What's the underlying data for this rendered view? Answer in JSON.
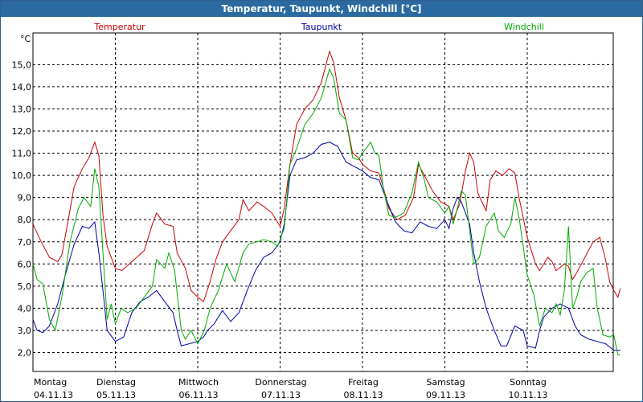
{
  "window": {
    "title": "Temperatur, Taupunkt, Windchill [°C]"
  },
  "chart_data": {
    "type": "line",
    "title": "Temperatur, Taupunkt, Windchill [°C]",
    "ylabel": "°C",
    "ylim": [
      1.5,
      16.5
    ],
    "xlim": [
      0,
      7.05
    ],
    "grid": true,
    "legend_placement": "top",
    "yticks": [
      2,
      3,
      4,
      5,
      6,
      7,
      8,
      9,
      10,
      11,
      12,
      13,
      14,
      15
    ],
    "ytick_labels": [
      "2,0",
      "3,0",
      "4,0",
      "5,0",
      "6,0",
      "7,0",
      "8,0",
      "9,0",
      "10,0",
      "11,0",
      "12,0",
      "13,0",
      "14,0",
      "15,0"
    ],
    "x_day_labels": [
      {
        "day": "Montag",
        "date": "04.11.13"
      },
      {
        "day": "Dienstag",
        "date": "05.11.13"
      },
      {
        "day": "Mittwoch",
        "date": "06.11.13"
      },
      {
        "day": "Donnerstag",
        "date": "07.11.13"
      },
      {
        "day": "Freitag",
        "date": "08.11.13"
      },
      {
        "day": "Samstag",
        "date": "09.11.13"
      },
      {
        "day": "Sonntag",
        "date": "10.11.13"
      }
    ],
    "series": [
      {
        "name": "Temperatur",
        "color": "#cc0000",
        "points": [
          [
            0,
            7.8
          ],
          [
            0.1,
            7.0
          ],
          [
            0.2,
            6.3
          ],
          [
            0.3,
            6.1
          ],
          [
            0.35,
            6.4
          ],
          [
            0.42,
            7.8
          ],
          [
            0.5,
            9.5
          ],
          [
            0.6,
            10.3
          ],
          [
            0.68,
            10.8
          ],
          [
            0.75,
            11.5
          ],
          [
            0.8,
            10.9
          ],
          [
            0.85,
            8.2
          ],
          [
            0.9,
            6.8
          ],
          [
            1.0,
            5.8
          ],
          [
            1.08,
            5.7
          ],
          [
            1.2,
            6.1
          ],
          [
            1.35,
            6.6
          ],
          [
            1.45,
            7.8
          ],
          [
            1.5,
            8.3
          ],
          [
            1.6,
            7.8
          ],
          [
            1.7,
            7.7
          ],
          [
            1.75,
            6.5
          ],
          [
            1.85,
            5.8
          ],
          [
            1.92,
            4.8
          ],
          [
            2.0,
            4.5
          ],
          [
            2.07,
            4.3
          ],
          [
            2.15,
            5.2
          ],
          [
            2.22,
            6.2
          ],
          [
            2.3,
            7.0
          ],
          [
            2.42,
            7.6
          ],
          [
            2.5,
            8.0
          ],
          [
            2.55,
            8.9
          ],
          [
            2.62,
            8.4
          ],
          [
            2.72,
            8.8
          ],
          [
            2.8,
            8.6
          ],
          [
            2.9,
            8.3
          ],
          [
            3.0,
            7.7
          ],
          [
            3.05,
            8.5
          ],
          [
            3.12,
            10.5
          ],
          [
            3.2,
            12.3
          ],
          [
            3.3,
            13.0
          ],
          [
            3.4,
            13.4
          ],
          [
            3.5,
            14.2
          ],
          [
            3.6,
            15.6
          ],
          [
            3.65,
            15.1
          ],
          [
            3.72,
            13.5
          ],
          [
            3.8,
            12.5
          ],
          [
            3.88,
            11.0
          ],
          [
            3.95,
            10.8
          ],
          [
            4.0,
            10.5
          ],
          [
            4.1,
            10.2
          ],
          [
            4.2,
            10.1
          ],
          [
            4.25,
            9.5
          ],
          [
            4.32,
            8.5
          ],
          [
            4.42,
            8.0
          ],
          [
            4.52,
            8.2
          ],
          [
            4.62,
            9.0
          ],
          [
            4.68,
            10.5
          ],
          [
            4.75,
            10.0
          ],
          [
            4.85,
            9.3
          ],
          [
            4.95,
            8.8
          ],
          [
            5.05,
            8.6
          ],
          [
            5.1,
            8.0
          ],
          [
            5.18,
            8.7
          ],
          [
            5.25,
            10.2
          ],
          [
            5.3,
            11.0
          ],
          [
            5.35,
            10.6
          ],
          [
            5.4,
            9.2
          ],
          [
            5.45,
            8.8
          ],
          [
            5.5,
            8.4
          ],
          [
            5.55,
            9.8
          ],
          [
            5.62,
            10.2
          ],
          [
            5.7,
            10.0
          ],
          [
            5.78,
            10.3
          ],
          [
            5.85,
            10.1
          ],
          [
            5.9,
            9.0
          ],
          [
            6.0,
            7.2
          ],
          [
            6.1,
            6.0
          ],
          [
            6.15,
            5.7
          ],
          [
            6.2,
            6.0
          ],
          [
            6.25,
            6.3
          ],
          [
            6.3,
            6.1
          ],
          [
            6.35,
            5.7
          ],
          [
            6.45,
            6.0
          ],
          [
            6.5,
            5.9
          ],
          [
            6.55,
            5.3
          ],
          [
            6.6,
            5.6
          ],
          [
            6.7,
            6.3
          ],
          [
            6.8,
            7.0
          ],
          [
            6.88,
            7.2
          ],
          [
            6.95,
            6.2
          ],
          [
            7.0,
            5.2
          ],
          [
            7.05,
            4.8
          ],
          [
            7.1,
            4.5
          ],
          [
            7.13,
            4.9
          ]
        ]
      },
      {
        "name": "Taupunkt",
        "color": "#0000aa",
        "points": [
          [
            0,
            3.5
          ],
          [
            0.05,
            3.0
          ],
          [
            0.12,
            2.9
          ],
          [
            0.2,
            3.2
          ],
          [
            0.3,
            4.2
          ],
          [
            0.4,
            5.6
          ],
          [
            0.5,
            6.9
          ],
          [
            0.6,
            7.7
          ],
          [
            0.68,
            7.6
          ],
          [
            0.75,
            7.9
          ],
          [
            0.8,
            6.5
          ],
          [
            0.85,
            4.8
          ],
          [
            0.9,
            3.0
          ],
          [
            1.0,
            2.5
          ],
          [
            1.1,
            2.7
          ],
          [
            1.2,
            3.8
          ],
          [
            1.3,
            4.3
          ],
          [
            1.4,
            4.5
          ],
          [
            1.5,
            4.8
          ],
          [
            1.6,
            4.3
          ],
          [
            1.7,
            3.8
          ],
          [
            1.75,
            3.0
          ],
          [
            1.8,
            2.3
          ],
          [
            1.9,
            2.4
          ],
          [
            2.0,
            2.5
          ],
          [
            2.07,
            2.7
          ],
          [
            2.12,
            3.0
          ],
          [
            2.2,
            3.3
          ],
          [
            2.3,
            3.9
          ],
          [
            2.4,
            3.4
          ],
          [
            2.5,
            3.8
          ],
          [
            2.6,
            4.8
          ],
          [
            2.7,
            5.7
          ],
          [
            2.8,
            6.3
          ],
          [
            2.9,
            6.5
          ],
          [
            3.0,
            7.0
          ],
          [
            3.05,
            7.8
          ],
          [
            3.12,
            10.0
          ],
          [
            3.2,
            10.7
          ],
          [
            3.3,
            10.8
          ],
          [
            3.4,
            11.0
          ],
          [
            3.5,
            11.4
          ],
          [
            3.6,
            11.5
          ],
          [
            3.7,
            11.3
          ],
          [
            3.8,
            10.6
          ],
          [
            3.9,
            10.4
          ],
          [
            4.0,
            10.2
          ],
          [
            4.1,
            9.9
          ],
          [
            4.2,
            9.8
          ],
          [
            4.3,
            8.8
          ],
          [
            4.4,
            7.9
          ],
          [
            4.5,
            7.5
          ],
          [
            4.6,
            7.4
          ],
          [
            4.7,
            7.9
          ],
          [
            4.8,
            7.7
          ],
          [
            4.9,
            7.6
          ],
          [
            5.0,
            8.0
          ],
          [
            5.05,
            7.6
          ],
          [
            5.1,
            8.5
          ],
          [
            5.15,
            9.0
          ],
          [
            5.2,
            8.8
          ],
          [
            5.3,
            7.8
          ],
          [
            5.35,
            6.5
          ],
          [
            5.42,
            5.2
          ],
          [
            5.5,
            4.0
          ],
          [
            5.6,
            3.0
          ],
          [
            5.68,
            2.3
          ],
          [
            5.75,
            2.3
          ],
          [
            5.85,
            3.2
          ],
          [
            5.95,
            3.0
          ],
          [
            6.0,
            2.3
          ],
          [
            6.1,
            2.2
          ],
          [
            6.15,
            3.0
          ],
          [
            6.2,
            3.6
          ],
          [
            6.3,
            4.0
          ],
          [
            6.4,
            4.2
          ],
          [
            6.5,
            4.0
          ],
          [
            6.58,
            3.2
          ],
          [
            6.65,
            2.8
          ],
          [
            6.75,
            2.6
          ],
          [
            6.85,
            2.5
          ],
          [
            6.95,
            2.4
          ],
          [
            7.05,
            2.1
          ],
          [
            7.13,
            2.1
          ]
        ]
      },
      {
        "name": "Windchill",
        "color": "#00aa00",
        "points": [
          [
            0,
            6.0
          ],
          [
            0.05,
            5.3
          ],
          [
            0.12,
            5.1
          ],
          [
            0.2,
            3.5
          ],
          [
            0.27,
            3.0
          ],
          [
            0.35,
            4.5
          ],
          [
            0.45,
            7.0
          ],
          [
            0.55,
            8.5
          ],
          [
            0.62,
            9.0
          ],
          [
            0.7,
            8.6
          ],
          [
            0.75,
            10.3
          ],
          [
            0.8,
            9.5
          ],
          [
            0.85,
            6.5
          ],
          [
            0.9,
            3.5
          ],
          [
            0.95,
            4.2
          ],
          [
            1.0,
            3.3
          ],
          [
            1.07,
            4.0
          ],
          [
            1.15,
            3.8
          ],
          [
            1.25,
            4.0
          ],
          [
            1.35,
            4.5
          ],
          [
            1.45,
            5.0
          ],
          [
            1.5,
            6.2
          ],
          [
            1.6,
            5.8
          ],
          [
            1.65,
            6.5
          ],
          [
            1.72,
            5.7
          ],
          [
            1.8,
            3.0
          ],
          [
            1.85,
            2.6
          ],
          [
            1.92,
            3.0
          ],
          [
            2.0,
            2.4
          ],
          [
            2.08,
            3.0
          ],
          [
            2.15,
            4.0
          ],
          [
            2.25,
            4.8
          ],
          [
            2.35,
            6.0
          ],
          [
            2.45,
            5.2
          ],
          [
            2.55,
            6.5
          ],
          [
            2.62,
            6.9
          ],
          [
            2.72,
            7.0
          ],
          [
            2.8,
            7.1
          ],
          [
            2.9,
            7.0
          ],
          [
            2.97,
            6.8
          ],
          [
            3.05,
            7.6
          ],
          [
            3.12,
            10.5
          ],
          [
            3.2,
            11.2
          ],
          [
            3.3,
            12.3
          ],
          [
            3.4,
            12.8
          ],
          [
            3.5,
            13.5
          ],
          [
            3.6,
            14.8
          ],
          [
            3.65,
            14.4
          ],
          [
            3.72,
            12.8
          ],
          [
            3.8,
            12.5
          ],
          [
            3.88,
            10.8
          ],
          [
            3.95,
            10.7
          ],
          [
            4.0,
            11.0
          ],
          [
            4.1,
            11.5
          ],
          [
            4.15,
            11.0
          ],
          [
            4.2,
            10.9
          ],
          [
            4.25,
            9.5
          ],
          [
            4.32,
            8.2
          ],
          [
            4.4,
            8.1
          ],
          [
            4.5,
            8.3
          ],
          [
            4.6,
            9.2
          ],
          [
            4.68,
            10.6
          ],
          [
            4.75,
            9.8
          ],
          [
            4.8,
            9.0
          ],
          [
            4.9,
            8.8
          ],
          [
            5.0,
            8.3
          ],
          [
            5.05,
            8.6
          ],
          [
            5.1,
            7.8
          ],
          [
            5.15,
            8.5
          ],
          [
            5.2,
            9.3
          ],
          [
            5.25,
            9.1
          ],
          [
            5.3,
            7.5
          ],
          [
            5.35,
            6.0
          ],
          [
            5.42,
            6.3
          ],
          [
            5.5,
            7.7
          ],
          [
            5.6,
            8.3
          ],
          [
            5.65,
            7.5
          ],
          [
            5.72,
            7.2
          ],
          [
            5.8,
            7.8
          ],
          [
            5.85,
            9.0
          ],
          [
            5.9,
            8.1
          ],
          [
            6.0,
            5.5
          ],
          [
            6.08,
            4.6
          ],
          [
            6.15,
            3.2
          ],
          [
            6.22,
            4.0
          ],
          [
            6.3,
            3.8
          ],
          [
            6.35,
            4.2
          ],
          [
            6.4,
            3.7
          ],
          [
            6.45,
            4.8
          ],
          [
            6.5,
            7.7
          ],
          [
            6.55,
            4.0
          ],
          [
            6.6,
            4.5
          ],
          [
            6.65,
            5.2
          ],
          [
            6.72,
            5.6
          ],
          [
            6.8,
            5.8
          ],
          [
            6.85,
            4.0
          ],
          [
            6.92,
            2.8
          ],
          [
            7.0,
            2.7
          ],
          [
            7.05,
            2.8
          ],
          [
            7.1,
            1.9
          ],
          [
            7.13,
            1.9
          ]
        ]
      }
    ]
  }
}
